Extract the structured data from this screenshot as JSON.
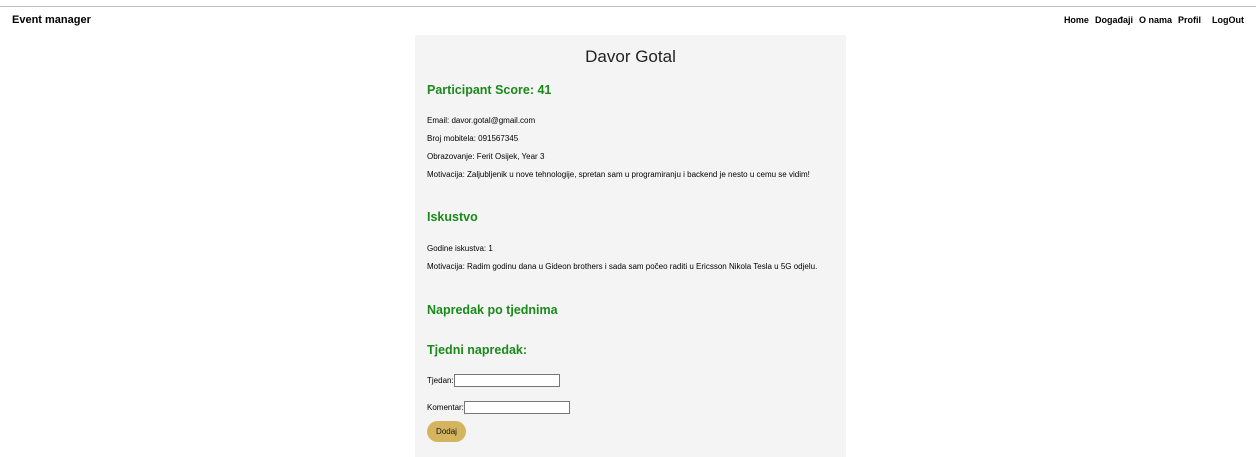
{
  "header": {
    "brand": "Event manager",
    "nav": [
      "Home",
      "Događaji",
      "O nama",
      "Profil",
      "LogOut"
    ]
  },
  "profile": {
    "name": "Davor Gotal",
    "score_heading": "Participant Score: 41",
    "email": "Email: davor.gotal@gmail.com",
    "phone": "Broj mobitela: 091567345",
    "education": "Obrazovanje: Ferit Osijek, Year 3",
    "motivation": "Motivacija: Zaljubljenik u nove tehnologije, spretan sam u programiranju i backend je nesto u cemu se vidim!"
  },
  "experience": {
    "heading": "Iskustvo",
    "years": "Godine iskustva: 1",
    "motivation": "Motivacija: Radim godinu dana u Gideon brothers i sada sam počeo raditi u Ericsson Nikola Tesla u 5G odjelu."
  },
  "progress": {
    "heading": "Napredak po tjednima"
  },
  "weekly_form": {
    "heading": "Tjedni napredak:",
    "week_label": "Tjedan:",
    "week_value": "",
    "comment_label": "Komentar:",
    "comment_value": "",
    "submit_label": "Dodaj"
  },
  "colors": {
    "heading_green": "#1a8a1a",
    "button_gold": "#d4b45e",
    "card_bg": "#f4f4f4"
  }
}
